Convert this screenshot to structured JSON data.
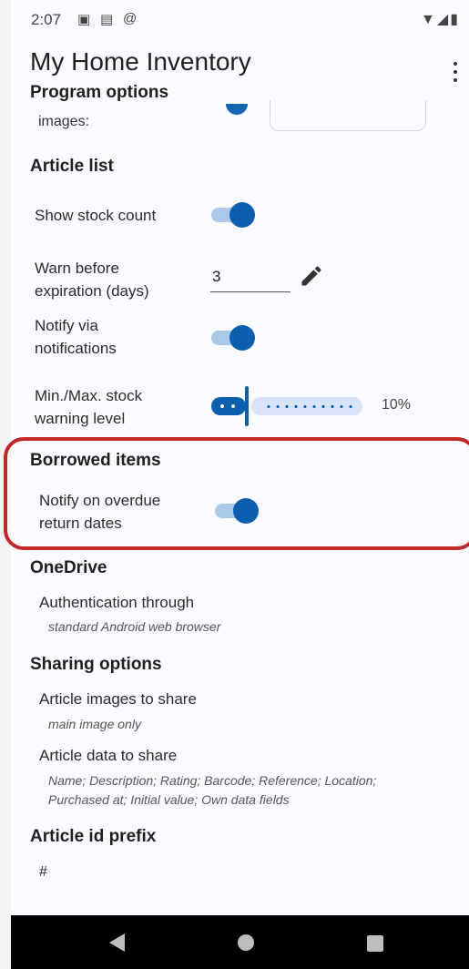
{
  "status_bar": {
    "time": "2:07",
    "left_icons": [
      "a-icon",
      "sim-icon",
      "at-icon"
    ],
    "right_icons": [
      "wifi-icon",
      "signal-icon",
      "battery-icon"
    ]
  },
  "app_bar": {
    "title": "My Home Inventory",
    "subtitle": "Program options"
  },
  "program_options": {
    "images_label": "images:"
  },
  "article_list": {
    "header": "Article list",
    "show_stock_count": {
      "label": "Show stock count",
      "enabled": true
    },
    "warn_before_expiration": {
      "label_line1": "Warn before",
      "label_line2": "expiration (days)",
      "value": "3"
    },
    "notify_via_notifications": {
      "label_line1": "Notify via",
      "label_line2": "notifications",
      "enabled": true
    },
    "stock_warning_level": {
      "label_line1": "Min./Max. stock",
      "label_line2": "warning level",
      "value_percent": 10,
      "value_text": "10%"
    }
  },
  "borrowed_items": {
    "header": "Borrowed items",
    "notify_overdue": {
      "label_line1": "Notify on overdue",
      "label_line2": "return dates",
      "enabled": true
    }
  },
  "onedrive": {
    "header": "OneDrive",
    "auth_label": "Authentication through",
    "auth_value": "standard Android web browser"
  },
  "sharing_options": {
    "header": "Sharing options",
    "images_label": "Article images to share",
    "images_value": "main image only",
    "data_label": "Article data to share",
    "data_value_line1": "Name; Description; Rating; Barcode; Reference; Location;",
    "data_value_line2": "Purchased at; Initial value; Own data fields"
  },
  "article_id_prefix": {
    "header": "Article id prefix",
    "value": "#"
  },
  "colors": {
    "accent": "#0b5fae",
    "accent_light": "#a9c8ea",
    "highlight_border": "#c0262a"
  },
  "nav_bar": [
    "back-icon",
    "home-icon",
    "recents-icon"
  ]
}
